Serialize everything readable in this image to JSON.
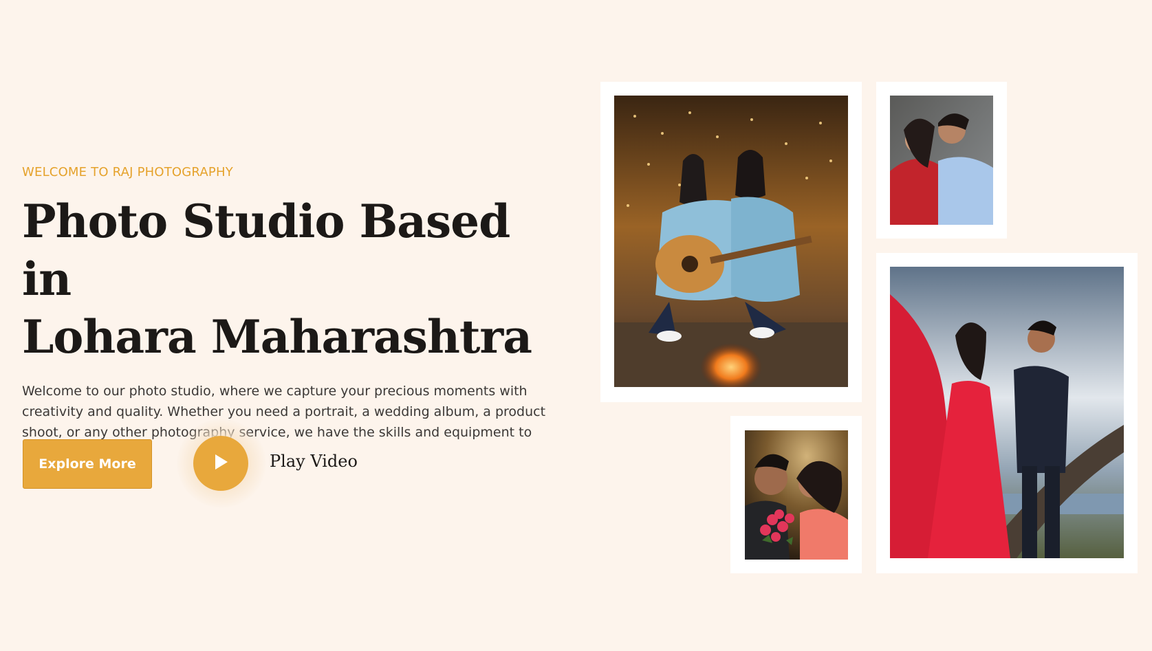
{
  "hero": {
    "eyebrow": "WELCOME TO RAJ PHOTOGRAPHY",
    "headline_line1": "Photo Studio Based in",
    "headline_line2": "Lohara Maharashtra",
    "intro": "Welcome to our photo studio, where we capture your precious moments with creativity and quality. Whether you need a portrait, a wedding album, a product shoot, or any other photography service, we have the skills and equipment to meet your needs."
  },
  "actions": {
    "explore_label": "Explore More",
    "play_label": "Play Video",
    "play_icon": "play-icon"
  },
  "colors": {
    "background": "#fdf4ec",
    "accent": "#e8a83c",
    "eyebrow": "#e5a22b",
    "heading": "#1c1917"
  }
}
